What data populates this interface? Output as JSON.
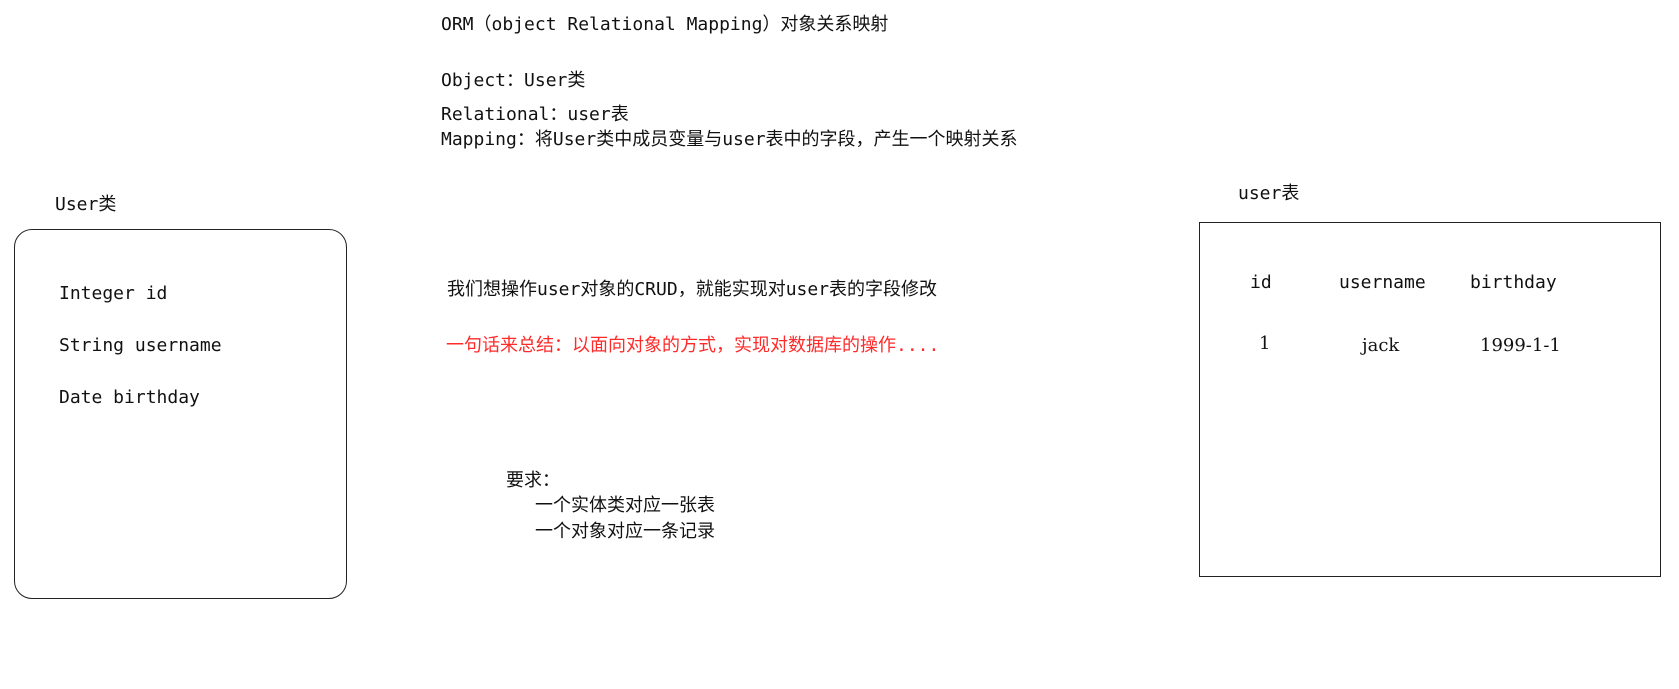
{
  "header": {
    "title": "ORM（object Relational Mapping）对象关系映射",
    "object_line": "Object：User类",
    "relational_line": "Relational：user表",
    "mapping_line": "Mapping：将User类中成员变量与user表中的字段，产生一个映射关系"
  },
  "user_class": {
    "label": "User类",
    "fields": [
      "Integer id",
      "String username",
      "Date birthday"
    ]
  },
  "middle": {
    "crud_text": "我们想操作user对象的CRUD，就能实现对user表的字段修改",
    "summary_text": "一句话来总结：以面向对象的方式，实现对数据库的操作....",
    "summary_color": "#ff2a2a",
    "requirements_title": "要求：",
    "requirements": [
      "一个实体类对应一张表",
      "一个对象对应一条记录"
    ]
  },
  "user_table": {
    "label": "user表",
    "columns": [
      "id",
      "username",
      "birthday"
    ],
    "rows": [
      [
        "1",
        "jack",
        "1999-1-1"
      ]
    ]
  }
}
